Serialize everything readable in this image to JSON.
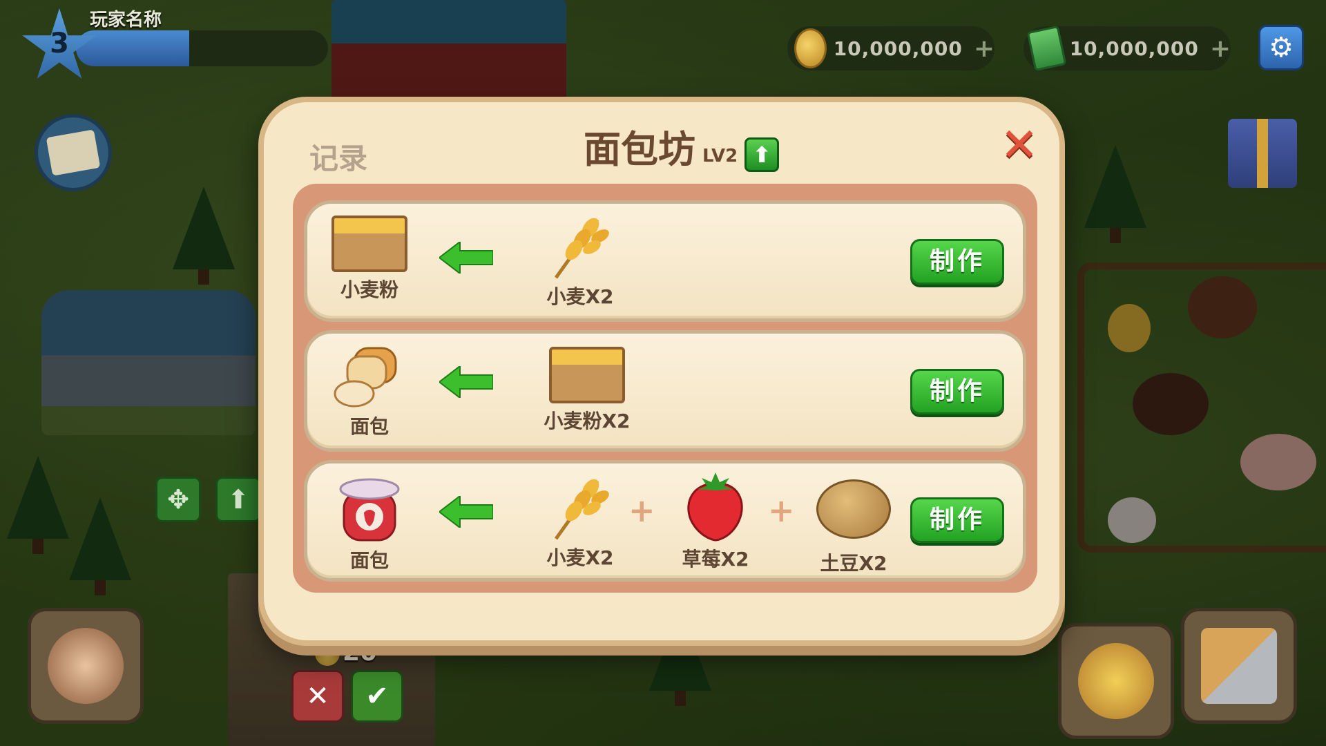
{
  "hud": {
    "player_name": "玩家名称",
    "level": "3",
    "xp_progress": 0.45,
    "coins": "10,000,000",
    "cash": "10,000,000",
    "plus": "+",
    "build_cost": "20"
  },
  "dialog": {
    "tab_label": "记录",
    "title": "面包坊",
    "level_label": "LV2",
    "make_label": "制作",
    "recipes": [
      {
        "product": {
          "label": "小麦粉",
          "icon": "flour-crate-icon"
        },
        "ingredients": [
          {
            "label": "小麦X2",
            "icon": "wheat-icon"
          }
        ]
      },
      {
        "product": {
          "label": "面包",
          "icon": "bread-icon"
        },
        "ingredients": [
          {
            "label": "小麦粉X2",
            "icon": "flour-crate-icon"
          }
        ]
      },
      {
        "product": {
          "label": "面包",
          "icon": "jam-jar-icon"
        },
        "ingredients": [
          {
            "label": "小麦X2",
            "icon": "wheat-icon"
          },
          {
            "label": "草莓X2",
            "icon": "strawberry-icon"
          },
          {
            "label": "土豆X2",
            "icon": "potato-icon"
          }
        ]
      }
    ]
  },
  "colors": {
    "make_button": "#22a222",
    "dialog_bg": "#f6e7c6",
    "close": "#e0533a",
    "title": "#6a4930"
  }
}
